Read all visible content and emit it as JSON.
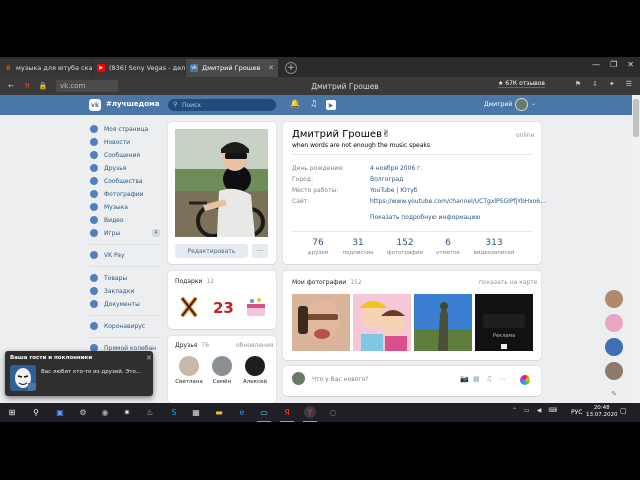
{
  "browser": {
    "tabs": [
      {
        "label": "музыка для ютуба скачать",
        "icon": "yandex-icon",
        "icon_color": "#fc3f1d"
      },
      {
        "label": "(836) Sony Vegas - делаем",
        "icon": "youtube-icon",
        "icon_color": "#ff0000"
      },
      {
        "label": "Дмитрий Грошев",
        "icon": "vk-icon",
        "icon_color": "#4a76a8"
      }
    ],
    "new_tab": "+",
    "window_controls": {
      "minimize": "—",
      "restore": "❐",
      "close": "✕"
    },
    "url": "vk.com",
    "page_title": "Дмитрий Грошев",
    "reviews": "★ 67К отзывов"
  },
  "vk": {
    "brand": "#лучшедома",
    "search_placeholder": "Поиск",
    "user_name": "Дмитрий",
    "accent_color": "#4a76a8",
    "menu": [
      {
        "label": "Моя страница",
        "icon": "home-icon"
      },
      {
        "label": "Новости",
        "icon": "news-icon"
      },
      {
        "label": "Сообщения",
        "icon": "messages-icon"
      },
      {
        "label": "Друзья",
        "icon": "friends-icon"
      },
      {
        "label": "Сообщества",
        "icon": "communities-icon"
      },
      {
        "label": "Фотографии",
        "icon": "photos-icon"
      },
      {
        "label": "Музыка",
        "icon": "music-icon"
      },
      {
        "label": "Видео",
        "icon": "video-icon"
      },
      {
        "label": "Игры",
        "icon": "games-icon",
        "badge": "4"
      },
      {
        "label": "VK Pay",
        "icon": "vkpay-icon"
      },
      {
        "label": "Товары",
        "icon": "goods-icon"
      },
      {
        "label": "Закладки",
        "icon": "bookmarks-icon"
      },
      {
        "label": "Документы",
        "icon": "documents-icon"
      },
      {
        "label": "Коронавирус",
        "icon": "coronavirus-icon"
      },
      {
        "label": "Прямой колебан",
        "icon": "link-icon"
      }
    ],
    "profile": {
      "name": "Дмитрий Грошев✌",
      "status": "when words are not enough the music speaks",
      "online": "online",
      "edit_button": "Редактировать",
      "more_button": "···",
      "info": [
        {
          "label": "День рождения:",
          "value": "4 ноября 2006 г."
        },
        {
          "label": "Город:",
          "value": "Волгоград"
        },
        {
          "label": "Место работы:",
          "value": "YouTube | Ютуб"
        },
        {
          "label": "Сайт:",
          "value": "https://www.youtube.com/channel/UCTgxlPSGIPfjYbHxo6..."
        }
      ],
      "show_more": "Показать подробную информацию",
      "stats": [
        {
          "value": "76",
          "label": "друзей"
        },
        {
          "value": "31",
          "label": "подписчик"
        },
        {
          "value": "152",
          "label": "фотографии"
        },
        {
          "value": "6",
          "label": "отметок"
        },
        {
          "value": "313",
          "label": "видеозаписей"
        }
      ]
    },
    "gifts": {
      "title": "Подарки",
      "count": "12"
    },
    "friends": {
      "title": "Друзья",
      "count": "76",
      "updates": "обновления",
      "items": [
        {
          "name": "Светлана"
        },
        {
          "name": "Семён"
        },
        {
          "name": "Алексей"
        }
      ]
    },
    "photos": {
      "title": "Мои фотографии",
      "count": "152",
      "show_on_map": "показать на карте",
      "video_label": "Реклама"
    },
    "composer": {
      "placeholder": "Что у Вас нового?"
    },
    "toast": {
      "title": "Ваша гости и поклонники",
      "message": "Вас любит кто-то из друзей. Это..."
    }
  },
  "taskbar": {
    "language": "РУС",
    "time": "20:48",
    "date": "13.07.2020"
  }
}
